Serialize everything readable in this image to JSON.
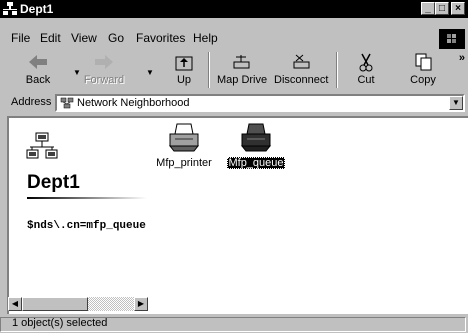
{
  "window": {
    "title": "Dept1"
  },
  "menu": [
    {
      "label": "File"
    },
    {
      "label": "Edit"
    },
    {
      "label": "View"
    },
    {
      "label": "Go"
    },
    {
      "label": "Favorites"
    },
    {
      "label": "Help"
    }
  ],
  "toolbar": {
    "back": "Back",
    "forward": "Forward",
    "up": "Up",
    "map_drive": "Map Drive",
    "disconnect": "Disconnect",
    "cut": "Cut",
    "copy": "Copy",
    "more": "»"
  },
  "address": {
    "label": "Address",
    "value": "Network Neighborhood"
  },
  "panel": {
    "heading": "Dept1",
    "nds": "$nds\\.cn=mfp_queue"
  },
  "items": [
    {
      "label": "Mfp_printer",
      "icon": "printer-icon",
      "selected": false
    },
    {
      "label": "Mfp_queue",
      "icon": "print-queue-icon",
      "selected": true
    }
  ],
  "status": {
    "text": "1 object(s) selected"
  },
  "colors": {
    "titlebar": "#000000",
    "selection": "#000000",
    "chrome": "#c0c0c0"
  }
}
